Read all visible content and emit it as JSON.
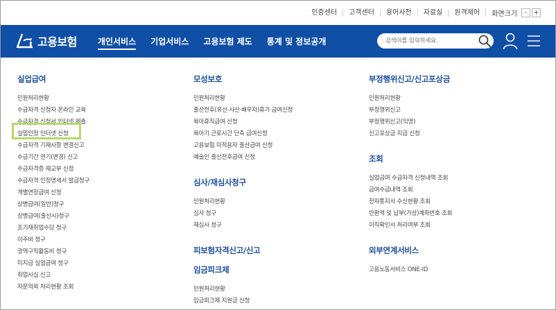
{
  "util_links": [
    "인증센터",
    "고객센터",
    "용어사전",
    "자료실",
    "원격제어"
  ],
  "zoom": {
    "label": "화면크기",
    "minus": "-",
    "plus": "+"
  },
  "logo": {
    "text": "고용보험"
  },
  "gnb": [
    "개인서비스",
    "기업서비스",
    "고용보험 제도",
    "통계 및 정보공개"
  ],
  "search": {
    "placeholder": "검색어를 입력하세요."
  },
  "columns": [
    {
      "sections": [
        {
          "title": "실업급여",
          "items": [
            "민원처리현황",
            "수급자격 신청자 온라인 교육",
            "수급자격 신청서 인터넷 제출",
            "실업인정 인터넷 신청",
            "수급자격 기재사항 변경신고",
            "수급기간 연기(변경) 신고",
            "수급자격증 재교부 신청",
            "수급자격 인정명세서 발급청구",
            "개별연장급여 신청",
            "상병급여(일반)청구",
            "상병급여(출산시)청구",
            "조기재취업수당 청구",
            "이주비 청구",
            "광역구직활동비 청구",
            "미지급 실업급여 청구",
            "취업사실 신고",
            "자문의뢰 처리현황 조회"
          ]
        }
      ]
    },
    {
      "sections": [
        {
          "title": "모성보호",
          "items": [
            "민원처리현황",
            "출산전후(유산·사산·배우자)휴가 급여신청",
            "육아휴직급여 신청",
            "육아기 근로시간 단축 급여신청",
            "고용보험 미적용자 출산급여 신청",
            "예술인 출산전후급여 신청"
          ]
        },
        {
          "title": "심사/재심사청구",
          "items": [
            "민원처리현황",
            "심사 청구",
            "재심사 청구"
          ]
        },
        {
          "title": "피보험자격신고/신고",
          "items": []
        },
        {
          "title": "임금피크제",
          "items": [
            "민원처리현황",
            "임금피크제 지원금 신청"
          ]
        }
      ]
    },
    {
      "sections": [
        {
          "title": "부정행위신고/신고포상금",
          "items": [
            "민원처리현황",
            "부정행위신고",
            "부정행위신고(익명)",
            "신고포상금 지급 신청"
          ]
        },
        {
          "title": "조회",
          "items": [
            "실업급여 수급자격 신청내역 조회",
            "급여수급내역 조회",
            "전자통지서 수신현황 조회",
            "반환액 및 납부(가상)계좌번호 조회",
            "이직확인서 처리여부 조회"
          ]
        },
        {
          "title": "외부연계서비스",
          "items": [
            "고용노동서비스 ONE-ID"
          ]
        }
      ]
    }
  ],
  "colors": {
    "header_bg": "#0f4fa6",
    "section_title": "#1f4fa0",
    "highlight": "#b5d96b"
  }
}
